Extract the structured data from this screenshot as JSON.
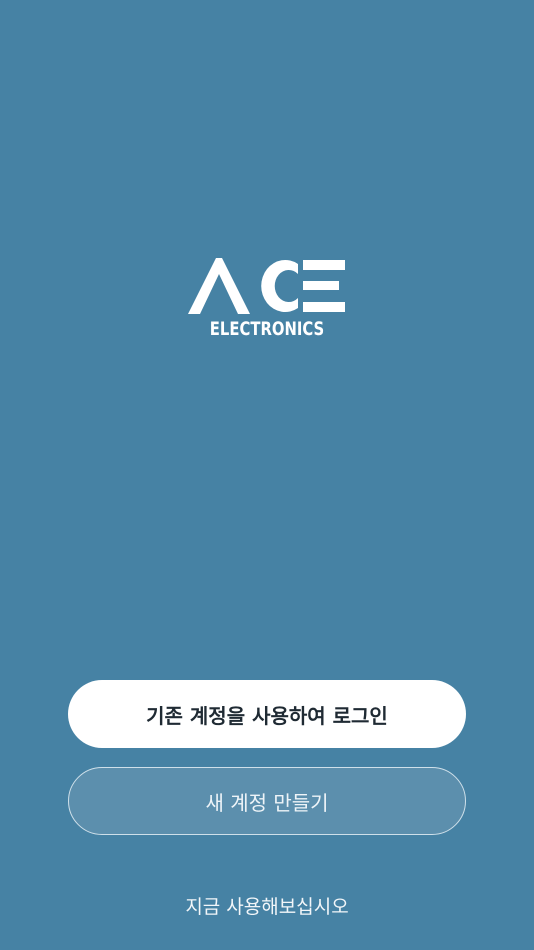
{
  "logo": {
    "brand": "ACE",
    "subtitle": "ELECTRONICS"
  },
  "actions": {
    "login_existing_label": "기존 계정을 사용하여 로그인",
    "create_account_label": "새 계정 만들기",
    "try_now_label": "지금 사용해보십시오"
  },
  "colors": {
    "background": "#4682a4",
    "primary_button_bg": "#ffffff",
    "primary_button_text": "#1f2a33",
    "secondary_button_bg": "#5c8fad",
    "secondary_button_border": "#cfe0ea"
  }
}
